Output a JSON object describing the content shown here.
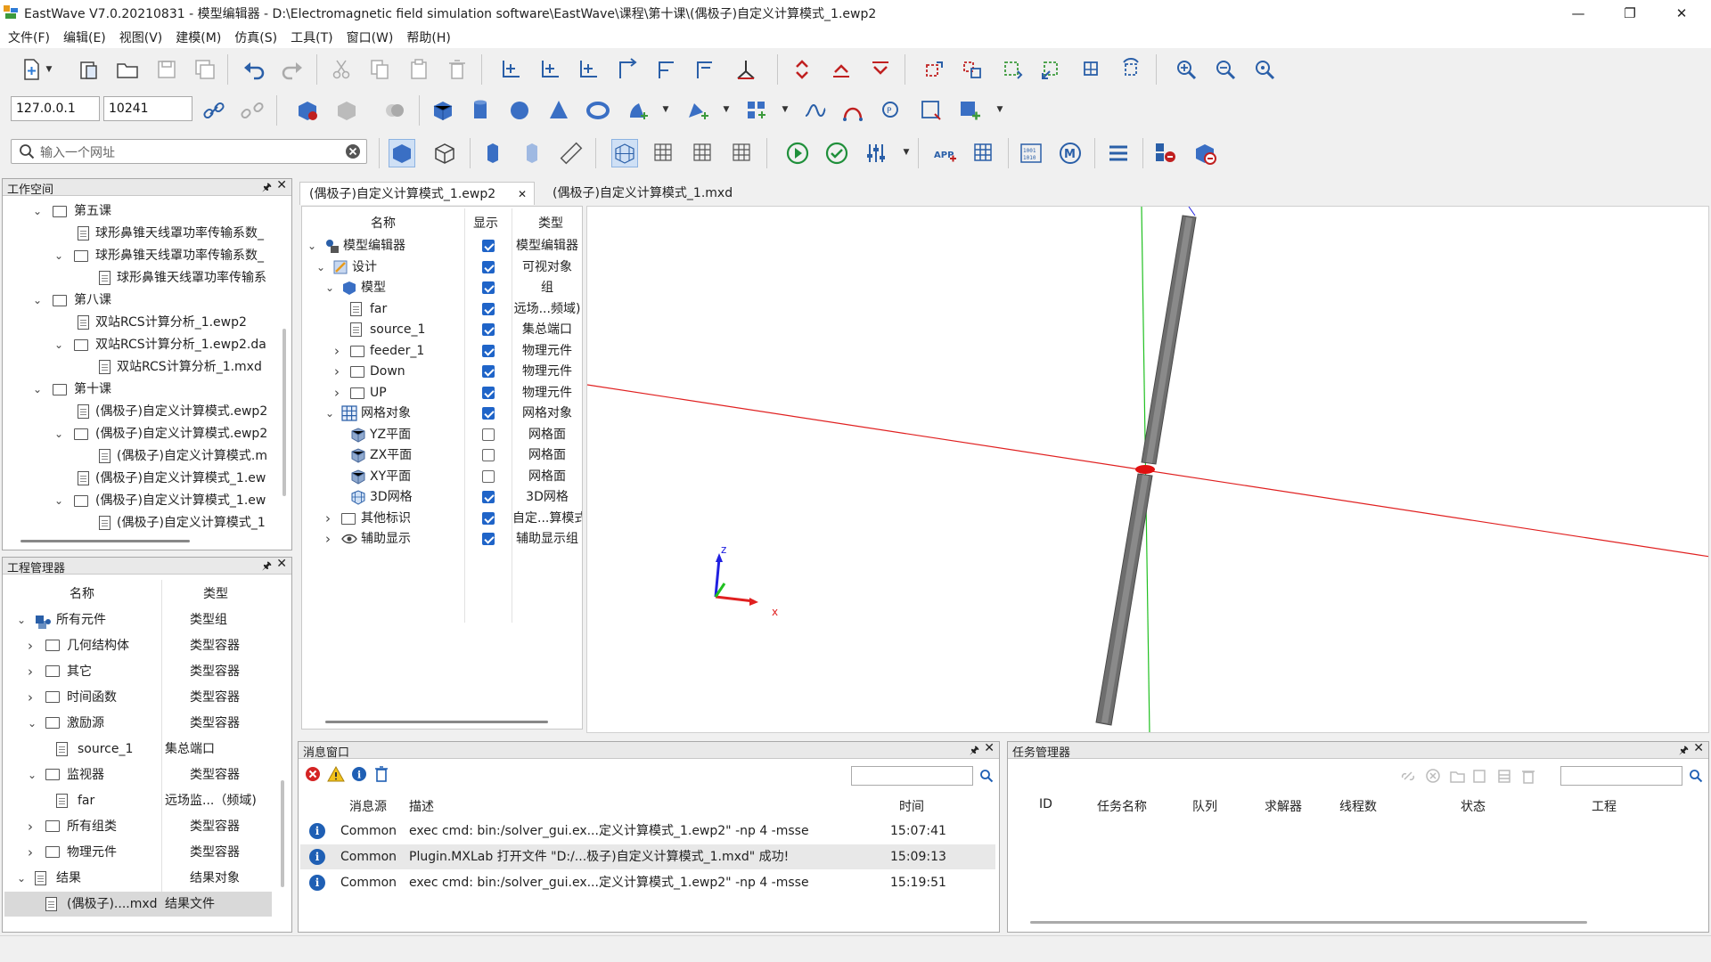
{
  "window": {
    "title": "EastWave V7.0.20210831  - 模型编辑器 - D:\\Electromagnetic field simulation software\\EastWave\\课程\\第十课\\(偶极子)自定义计算模式_1.ewp2",
    "minimize": "—",
    "restore": "❐",
    "close": "✕"
  },
  "menu": [
    "文件(F)",
    "编辑(E)",
    "视图(V)",
    "建模(M)",
    "仿真(S)",
    "工具(T)",
    "窗口(W)",
    "帮助(H)"
  ],
  "connection": {
    "host": "127.0.0.1",
    "port": "10241"
  },
  "search": {
    "placeholder": "输入一个网址",
    "value": ""
  },
  "workspace": {
    "title": "工作空间",
    "pin": "🖈",
    "close": "✕",
    "items": [
      "第五课",
      "球形鼻锥天线罩功率传输系数_",
      "球形鼻锥天线罩功率传输系数_",
      "球形鼻锥天线罩功率传输系",
      "第八课",
      "双站RCS计算分析_1.ewp2",
      "双站RCS计算分析_1.ewp2.da",
      "双站RCS计算分析_1.mxd",
      "第十课",
      "(偶极子)自定义计算模式.ewp2",
      "(偶极子)自定义计算模式.ewp2",
      "(偶极子)自定义计算模式.m",
      "(偶极子)自定义计算模式_1.ew",
      "(偶极子)自定义计算模式_1.ew",
      "(偶极子)自定义计算模式_1"
    ]
  },
  "project": {
    "title": "工程管理器",
    "col_name": "名称",
    "col_type": "类型",
    "rows": [
      {
        "name": "所有元件",
        "type": "类型组"
      },
      {
        "name": "几何结构体",
        "type": "类型容器"
      },
      {
        "name": "其它",
        "type": "类型容器"
      },
      {
        "name": "时间函数",
        "type": "类型容器"
      },
      {
        "name": "激励源",
        "type": "类型容器"
      },
      {
        "name": "source_1",
        "type": "集总端口"
      },
      {
        "name": "监视器",
        "type": "类型容器"
      },
      {
        "name": "far",
        "type": "远场监...（频域)"
      },
      {
        "name": "所有组类",
        "type": "类型容器"
      },
      {
        "name": "物理元件",
        "type": "类型容器"
      },
      {
        "name": "结果",
        "type": "结果对象"
      },
      {
        "name": "(偶极子)....mxd",
        "type": "结果文件"
      }
    ]
  },
  "tabs": [
    {
      "label": "(偶极子)自定义计算模式_1.ewp2",
      "close": "✕"
    },
    {
      "label": "(偶极子)自定义计算模式_1.mxd"
    }
  ],
  "model_tree": {
    "col_name": "名称",
    "col_show": "显示",
    "col_type": "类型",
    "rows": [
      {
        "name": "模型编辑器",
        "type": "模型编辑器",
        "checked": true
      },
      {
        "name": "设计",
        "type": "可视对象",
        "checked": true
      },
      {
        "name": "模型",
        "type": "组",
        "checked": true
      },
      {
        "name": "far",
        "type": "远场...频域)",
        "checked": true
      },
      {
        "name": "source_1",
        "type": "集总端口",
        "checked": true
      },
      {
        "name": "feeder_1",
        "type": "物理元件",
        "checked": true
      },
      {
        "name": "Down",
        "type": "物理元件",
        "checked": true
      },
      {
        "name": "UP",
        "type": "物理元件",
        "checked": true
      },
      {
        "name": "网格对象",
        "type": "网格对象",
        "checked": true
      },
      {
        "name": "YZ平面",
        "type": "网格面",
        "checked": false
      },
      {
        "name": "ZX平面",
        "type": "网格面",
        "checked": false
      },
      {
        "name": "XY平面",
        "type": "网格面",
        "checked": false
      },
      {
        "name": "3D网格",
        "type": "3D网格",
        "checked": true
      },
      {
        "name": "其他标识",
        "type": "自定...算模式",
        "checked": true
      },
      {
        "name": "辅助显示",
        "type": "辅助显示组",
        "checked": true
      }
    ]
  },
  "axes": {
    "z": "z",
    "x": "x"
  },
  "messages": {
    "title": "消息窗口",
    "col_source": "消息源",
    "col_desc": "描述",
    "col_time": "时间",
    "rows": [
      {
        "source": "Common",
        "desc": "exec cmd: bin:/solver_gui.ex...定义计算模式_1.ewp2\" -np 4  -msse",
        "time": "15:07:41"
      },
      {
        "source": "Common",
        "desc": "Plugin.MXLab 打开文件 \"D:/...极子)自定义计算模式_1.mxd\" 成功!",
        "time": "15:09:13"
      },
      {
        "source": "Common",
        "desc": "exec cmd: bin:/solver_gui.ex...定义计算模式_1.ewp2\" -np 4  -msse",
        "time": "15:19:51"
      }
    ]
  },
  "tasks": {
    "title": "任务管理器",
    "columns": [
      "ID",
      "任务名称",
      "队列",
      "求解器",
      "线程数",
      "状态",
      "工程"
    ]
  },
  "colors": {
    "accent": "#1f64c8",
    "axis_x": "#e02020",
    "axis_y": "#20c020",
    "axis_z": "#2020e0",
    "dipole": "#707070"
  }
}
